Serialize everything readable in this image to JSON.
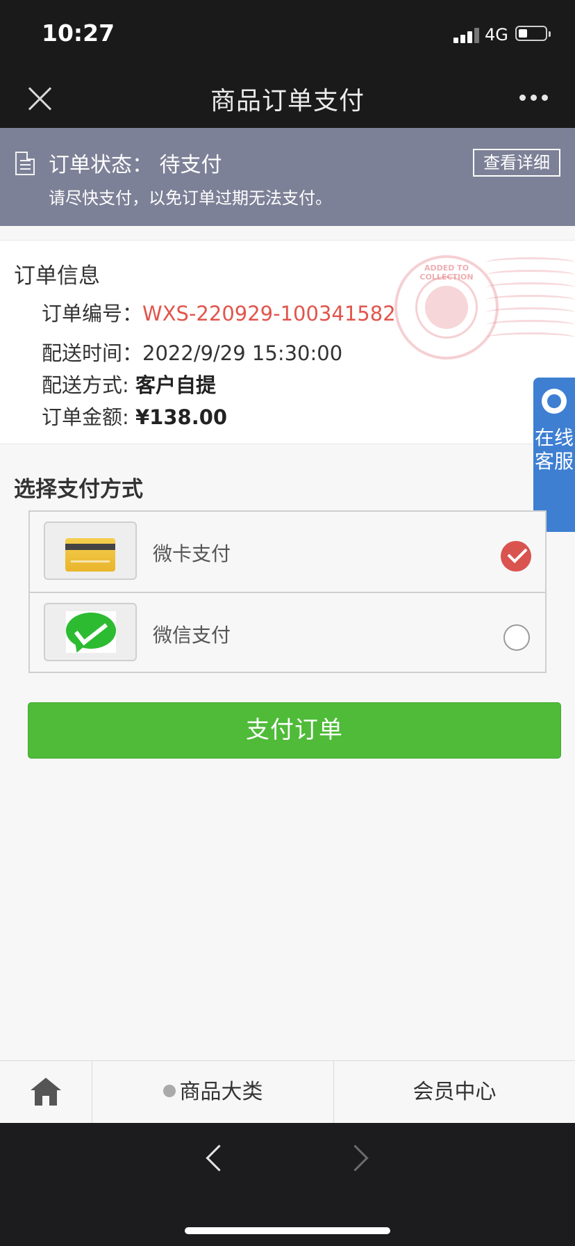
{
  "status_bar": {
    "time": "10:27",
    "network": "4G"
  },
  "nav": {
    "title": "商品订单支付",
    "close_icon": "close-icon",
    "more_icon": "more-icon"
  },
  "order_status": {
    "label": "订单状态：",
    "value": "待支付",
    "tip": "请尽快支付，以免订单过期无法支付。",
    "detail_button": "查看详细"
  },
  "order_info": {
    "title": "订单信息",
    "number_label": "订单编号：",
    "number_value": "WXS-220929-100341582",
    "time_label": "配送时间：",
    "time_value": "2022/9/29 15:30:00",
    "method_label": "配送方式: ",
    "method_value": "客户自提",
    "amount_label": "订单金额: ",
    "amount_value": "¥138.00",
    "stamp_text": "ADDED TO COLLECTION"
  },
  "service_tab": {
    "label": "在线客服"
  },
  "payment": {
    "title": "选择支付方式",
    "methods": [
      {
        "label": "微卡支付",
        "selected": true,
        "icon": "bank-card-icon"
      },
      {
        "label": "微信支付",
        "selected": false,
        "icon": "wechat-pay-icon"
      }
    ],
    "pay_button": "支付订单"
  },
  "tabbar": {
    "home_icon": "home-icon",
    "category": "商品大类",
    "member": "会员中心"
  },
  "colors": {
    "accent_green": "#4fbb39",
    "order_red": "#e0554c",
    "banner_bg": "#7d8197",
    "service_blue": "#3e7fd2",
    "selected_red": "#d9534f"
  }
}
